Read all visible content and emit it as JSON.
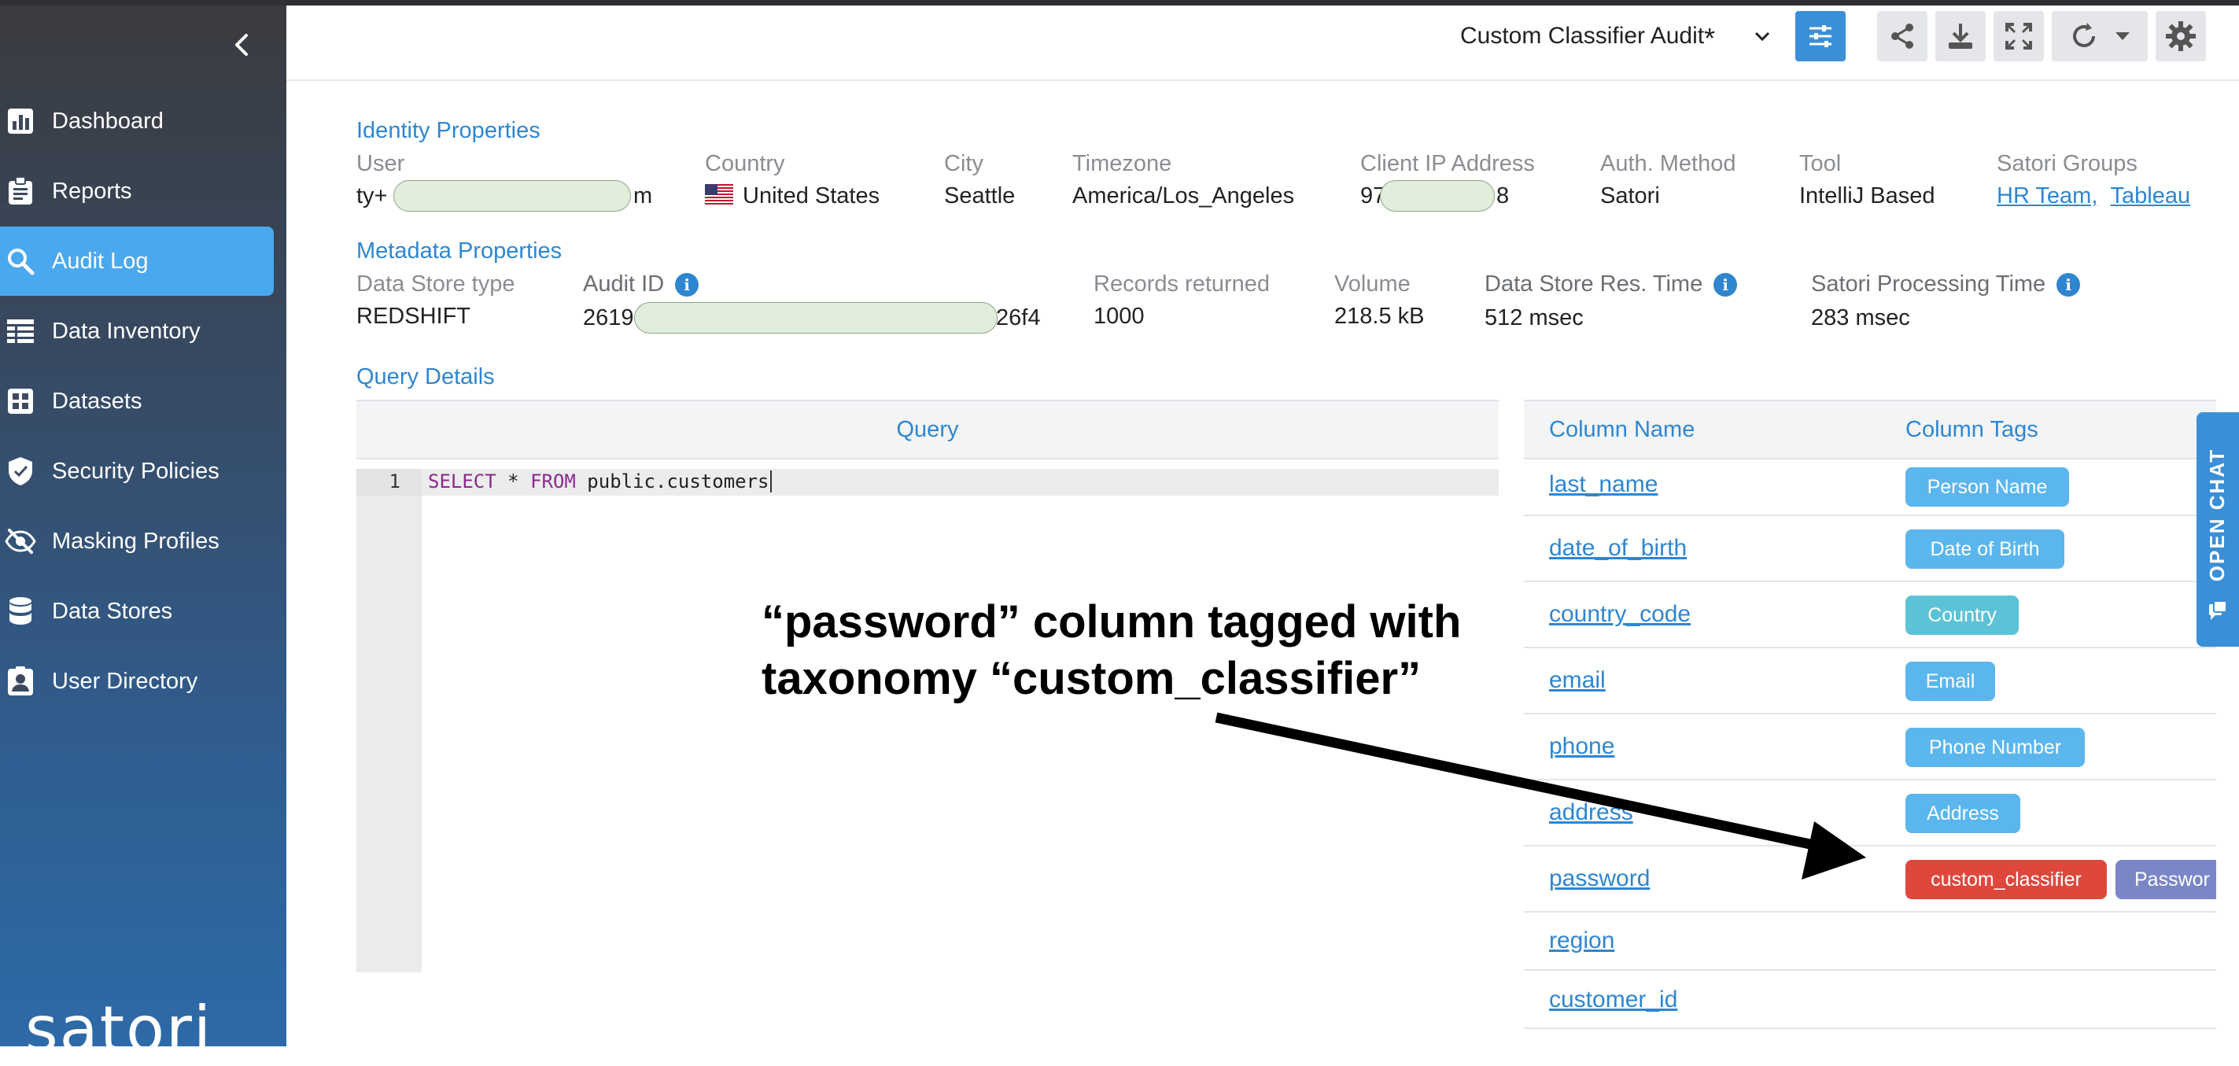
{
  "sidebar": {
    "items": [
      {
        "label": "Dashboard",
        "icon": "bar-chart-icon"
      },
      {
        "label": "Reports",
        "icon": "clipboard-icon"
      },
      {
        "label": "Audit Log",
        "icon": "search-icon"
      },
      {
        "label": "Data Inventory",
        "icon": "table-icon"
      },
      {
        "label": "Datasets",
        "icon": "grid-icon"
      },
      {
        "label": "Security Policies",
        "icon": "shield-icon"
      },
      {
        "label": "Masking Profiles",
        "icon": "eye-slash-icon"
      },
      {
        "label": "Data Stores",
        "icon": "database-icon"
      },
      {
        "label": "User Directory",
        "icon": "user-card-icon"
      }
    ],
    "active": "Audit Log",
    "brand": "satori"
  },
  "header": {
    "title": "Custom Classifier Audit",
    "modified_marker": "*"
  },
  "identity": {
    "section": "Identity Properties",
    "user_label": "User",
    "user_prefix": "ty+",
    "user_suffix": "m",
    "country_label": "Country",
    "country": "United States",
    "city_label": "City",
    "city": "Seattle",
    "timezone_label": "Timezone",
    "timezone": "America/Los_Angeles",
    "ip_label": "Client IP Address",
    "ip_prefix": "97",
    "ip_suffix": "8",
    "auth_label": "Auth. Method",
    "auth": "Satori",
    "tool_label": "Tool",
    "tool": "IntelliJ Based",
    "groups_label": "Satori Groups",
    "groups": [
      "HR Team,",
      "Tableau"
    ]
  },
  "metadata": {
    "section": "Metadata Properties",
    "store_type_label": "Data Store type",
    "store_type": "REDSHIFT",
    "audit_id_label": "Audit ID",
    "audit_id_prefix": "2619",
    "audit_id_suffix": "26f4",
    "records_label": "Records returned",
    "records": "1000",
    "volume_label": "Volume",
    "volume": "218.5 kB",
    "res_time_label": "Data Store Res. Time",
    "res_time": "512 msec",
    "proc_time_label": "Satori Processing Time",
    "proc_time": "283 msec"
  },
  "query": {
    "section": "Query Details",
    "panel_title": "Query",
    "line_number": "1",
    "kw_select": "SELECT",
    "star": " * ",
    "kw_from": "FROM",
    "table": " public.customers"
  },
  "columns": {
    "header_name": "Column Name",
    "header_tags": "Column Tags",
    "rows": [
      {
        "name": "last_name",
        "tags": [
          "Person Name"
        ]
      },
      {
        "name": "date_of_birth",
        "tags": [
          "Date of Birth"
        ]
      },
      {
        "name": "country_code",
        "tags": [
          "Country"
        ]
      },
      {
        "name": "email",
        "tags": [
          "Email"
        ]
      },
      {
        "name": "phone",
        "tags": [
          "Phone Number"
        ]
      },
      {
        "name": "address",
        "tags": [
          "Address"
        ]
      },
      {
        "name": "password",
        "tags": [
          "custom_classifier",
          "Passwor"
        ]
      },
      {
        "name": "region",
        "tags": []
      },
      {
        "name": "customer_id",
        "tags": []
      }
    ]
  },
  "open_chat": "OPEN CHAT",
  "annotation": {
    "line1": "“password” column tagged with",
    "line2": "taxonomy “custom_classifier”"
  },
  "colors": {
    "accent": "#2f86d0",
    "active_nav": "#4aa8ef",
    "tag_blue": "#5bb6ee",
    "tag_teal": "#5cc3d6",
    "tag_red": "#e0473c",
    "tag_purple": "#7b86c9"
  }
}
